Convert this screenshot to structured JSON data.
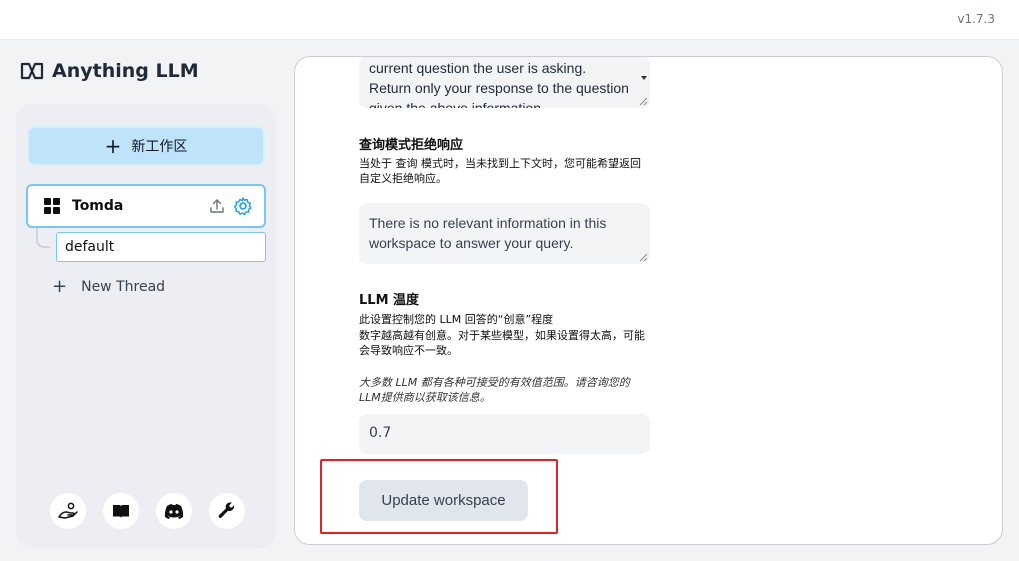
{
  "app": {
    "version": "v1.7.3",
    "logo_text": "Anything LLM"
  },
  "sidebar": {
    "new_workspace_label": "新工作区",
    "workspace": {
      "name": "Tomda"
    },
    "thread": {
      "name": "default"
    },
    "new_thread_label": "New Thread",
    "footer_icons": [
      "community-hub-icon",
      "docs-book-icon",
      "discord-icon",
      "settings-wrench-icon"
    ]
  },
  "settings": {
    "prompt_text": "current question the user is asking. Return only your response to the question given the above information",
    "refusal": {
      "title": "查询模式拒绝响应",
      "description": "当处于 查询 模式时，当未找到上下文时，您可能希望返回自定义拒绝响应。",
      "value": "There is no relevant information in this workspace to answer your query."
    },
    "temperature": {
      "title": "LLM 温度",
      "description_line1": "此设置控制您的 LLM 回答的“创意”程度",
      "description_line2": "数字越高越有创意。对于某些模型，如果设置得太高，可能会导致响应不一致。",
      "note": "大多数 LLM 都有各种可接受的有效值范围。请咨询您的LLM提供商以获取该信息。",
      "value": "0.7"
    },
    "update_button": "Update workspace"
  },
  "colors": {
    "accent": "#7cc4f3",
    "new_workspace_bg": "#bfe3fb",
    "highlight": "#e02424"
  }
}
